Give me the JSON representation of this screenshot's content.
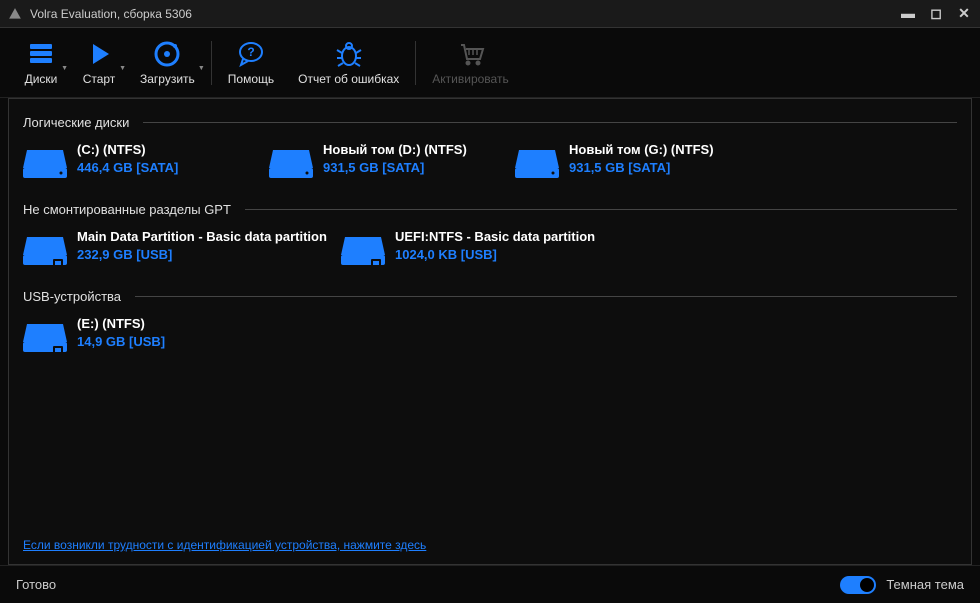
{
  "titlebar": {
    "text": "Volга Evaluation, сборка 5306"
  },
  "toolbar": {
    "disks": "Диски",
    "start": "Старт",
    "load": "Загрузить",
    "help": "Помощь",
    "bugreport": "Отчет об ошибках",
    "activate": "Активировать"
  },
  "sections": {
    "logical": "Логические диски",
    "gpt": "Не смонтированные разделы GPT",
    "usb": "USB-устройства"
  },
  "drives": {
    "logical": [
      {
        "name": "(C:) (NTFS)",
        "size": "446,4 GB [SATA]"
      },
      {
        "name": "Новый том (D:) (NTFS)",
        "size": "931,5 GB [SATA]"
      },
      {
        "name": "Новый том (G:) (NTFS)",
        "size": "931,5 GB [SATA]"
      }
    ],
    "gpt": [
      {
        "name": "Main Data Partition - Basic data partition",
        "size": "232,9 GB [USB]"
      },
      {
        "name": "UEFI:NTFS - Basic data partition",
        "size": "1024,0 KB [USB]"
      }
    ],
    "usb": [
      {
        "name": "(E:) (NTFS)",
        "size": "14,9 GB [USB]"
      }
    ]
  },
  "help_link": "Если возникли трудности с идентификацией устройства, нажмите здесь",
  "statusbar": {
    "ready": "Готово",
    "theme": "Темная тема"
  }
}
